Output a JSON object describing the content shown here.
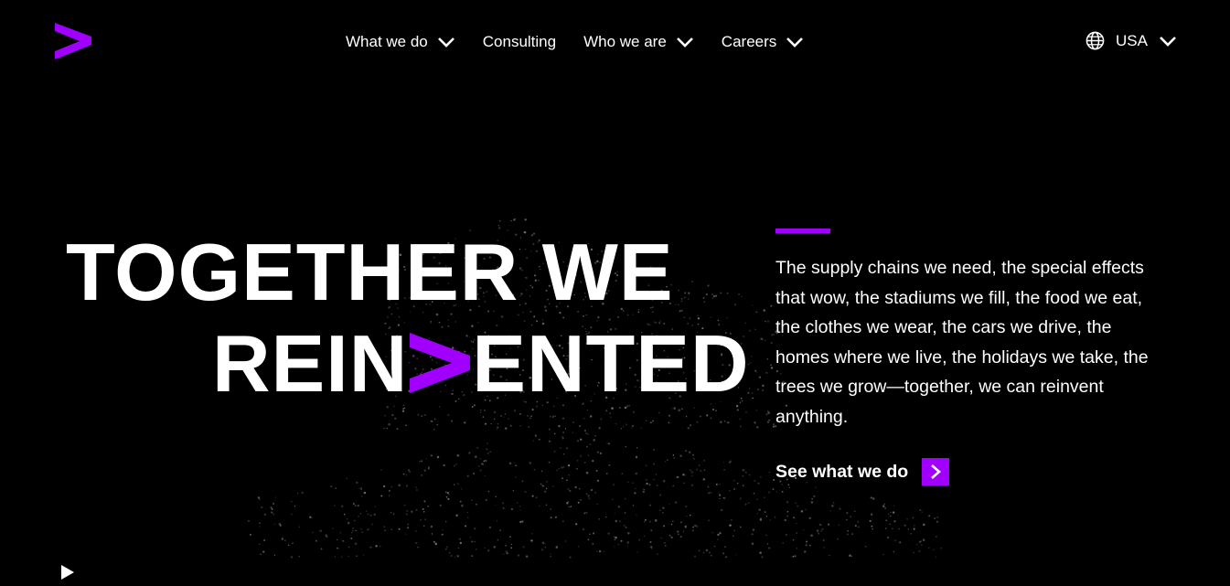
{
  "brand": {
    "logo_icon": "accenture-greater-than-logo-icon",
    "accent_color": "#a100ff"
  },
  "nav": {
    "items": [
      {
        "label": "What we do",
        "has_dropdown": true
      },
      {
        "label": "Consulting",
        "has_dropdown": false
      },
      {
        "label": "Who we are",
        "has_dropdown": true
      },
      {
        "label": "Careers",
        "has_dropdown": true
      }
    ]
  },
  "locale": {
    "icon": "globe-icon",
    "label": "USA"
  },
  "hero": {
    "headline_line1": "TOGETHER WE",
    "headline_line2_start": "REIN",
    "headline_line2_end": "ENTED",
    "description": "The supply chains we need, the special effects that wow, the stadiums we fill, the food we eat, the clothes we wear, the cars we drive, the homes where we live, the holidays we take, the trees we grow—together, we can reinvent anything.",
    "cta_label": "See what we do",
    "cta_icon": "chevron-right-icon"
  },
  "media": {
    "play_icon": "play-icon"
  }
}
